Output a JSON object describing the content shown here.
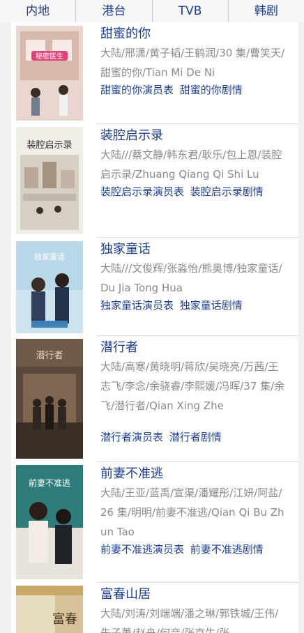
{
  "tabs": [
    "内地",
    "港台",
    "TVB",
    "韩剧"
  ],
  "items": [
    {
      "title": "甜蜜的你",
      "info": "大陆/邢潇/黄子韬/王鹤润/30 集/曹笑天/甜蜜的你/Tian Mi De Ni",
      "cast_link": "甜蜜的你演员表",
      "plot_link": "甜蜜的你剧情",
      "poster_text": "秘密医生"
    },
    {
      "title": "装腔启示录",
      "info": "大陆///蔡文静/韩东君/耿乐/包上恩/装腔启示录/Zhuang Qiang Qi Shi Lu",
      "cast_link": "装腔启示录演员表",
      "plot_link": "装腔启示录剧情",
      "poster_text": "装腔启示录"
    },
    {
      "title": "独家童话",
      "info": "大陆///文俊辉/张淼怡/熊奥博/独家童话/Du Jia Tong Hua",
      "cast_link": "独家童话演员表",
      "plot_link": "独家童话剧情",
      "poster_text": "独家童话"
    },
    {
      "title": "潜行者",
      "info": "大陆/高寒/黄晓明/蒋欣/吴晓亮/万茜/王志飞/李念/余骁睿/李熙媛/冯晖/37 集/余飞/潜行者/Qian Xing Zhe",
      "cast_link": "潜行者演员表",
      "plot_link": "潜行者剧情",
      "poster_text": "潜行者"
    },
    {
      "title": "前妻不准逃",
      "info": "大陆/王亚/蓝禹/宣渠/潘耀彤/江妍/阿盐/26 集/明明/前妻不准逃/Qian Qi Bu Zhun Tao",
      "cast_link": "前妻不准逃演员表",
      "plot_link": "前妻不准逃剧情",
      "poster_text": "前妻不准逃"
    },
    {
      "title": "富春山居",
      "info": "大陆/刘涛/刘端端/潘之琳/郭铁城/王伟/朱子萧/赵舟/何音/张京生/张",
      "cast_link": "",
      "plot_link": "",
      "poster_text": "富春"
    }
  ]
}
